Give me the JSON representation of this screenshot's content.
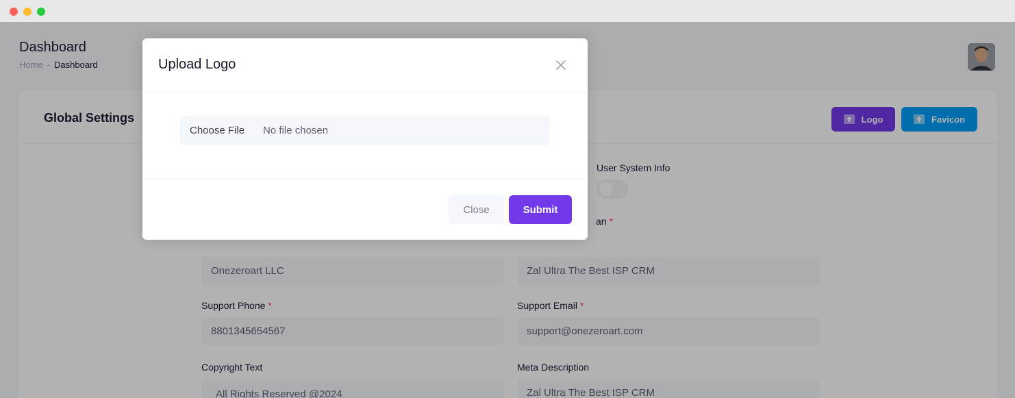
{
  "header": {
    "title": "Dashboard",
    "breadcrumb": {
      "home": "Home",
      "separator": "-",
      "current": "Dashboard"
    }
  },
  "card": {
    "title": "Global Settings",
    "logo_button": "Logo",
    "favicon_button": "Favicon"
  },
  "form": {
    "user_system_info_label": "User System Info",
    "slogan_label_fragment": "an",
    "required_marker": "*",
    "company_name_value": "Onezeroart LLC",
    "slogan_value": "Zal Ultra The Best ISP CRM",
    "support_phone_label": "Support Phone",
    "support_phone_value": "8801345654567",
    "support_email_label": "Support Email",
    "support_email_value": "support@onezeroart.com",
    "copyright_label": "Copyright Text",
    "copyright_value": "All Rights Reserved @2024",
    "meta_description_label": "Meta Description",
    "meta_description_value": "Zal Ultra The Best ISP CRM"
  },
  "modal": {
    "title": "Upload Logo",
    "choose_file": "Choose File",
    "no_file": "No file chosen",
    "close_button": "Close",
    "submit_button": "Submit"
  },
  "colors": {
    "primary": "#7239ea",
    "info": "#009ef7",
    "required": "#f1416c"
  },
  "icons": [
    "upload-icon",
    "close-icon",
    "avatar"
  ]
}
